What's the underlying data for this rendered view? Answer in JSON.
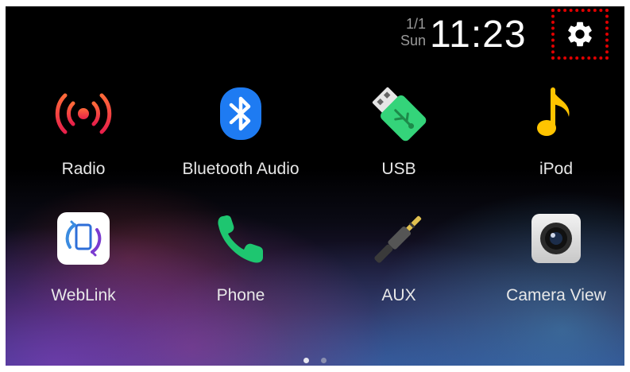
{
  "status": {
    "date_top": "1/1",
    "date_bottom": "Sun",
    "time": "11:23"
  },
  "settings": {
    "icon": "gear-icon"
  },
  "apps": [
    {
      "label": "Radio",
      "icon": "radio-broadcast-icon",
      "color": "#ff4a2a"
    },
    {
      "label": "Bluetooth Audio",
      "icon": "bluetooth-icon",
      "color": "#1a73e8"
    },
    {
      "label": "USB",
      "icon": "usb-drive-icon",
      "color": "#36d67a"
    },
    {
      "label": "iPod",
      "icon": "music-note-icon",
      "color": "#ffc400"
    },
    {
      "label": "WebLink",
      "icon": "weblink-icon",
      "color": "#ffffff"
    },
    {
      "label": "Phone",
      "icon": "phone-handset-icon",
      "color": "#1ec670"
    },
    {
      "label": "AUX",
      "icon": "aux-jack-icon",
      "color": "#d8b838"
    },
    {
      "label": "Camera View",
      "icon": "camera-icon",
      "color": "#d8d8d8"
    }
  ],
  "pager": {
    "current_page": 1,
    "total_pages": 2
  }
}
